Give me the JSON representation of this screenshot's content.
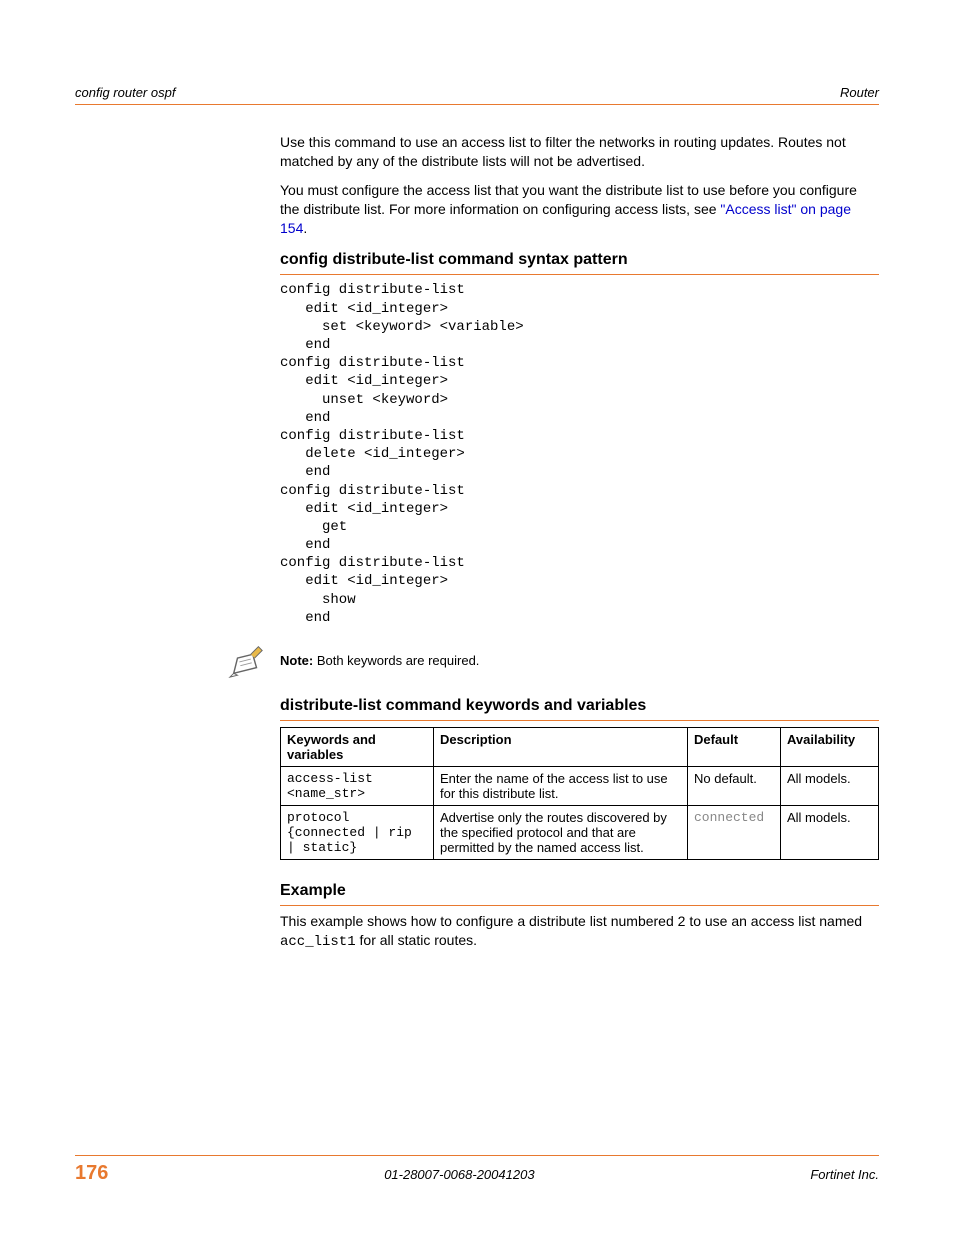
{
  "header": {
    "left": "config router ospf",
    "right": "Router"
  },
  "intro": {
    "p1": "Use this command to use an access list to filter the networks in routing updates. Routes not matched by any of the distribute lists will not be advertised.",
    "p2a": "You must configure the access list that you want the distribute list to use before you configure the distribute list. For more information on configuring access lists, see ",
    "p2_link": "\"Access list\" on page 154",
    "p2b": "."
  },
  "section1": {
    "heading": "config distribute-list command syntax pattern",
    "code": "config distribute-list\n   edit <id_integer>\n     set <keyword> <variable>\n   end\nconfig distribute-list\n   edit <id_integer>\n     unset <keyword>\n   end\nconfig distribute-list\n   delete <id_integer>\n   end\nconfig distribute-list\n   edit <id_integer>\n     get\n   end\nconfig distribute-list\n   edit <id_integer>\n     show\n   end"
  },
  "note": {
    "label": "Note:",
    "text": " Both keywords are required."
  },
  "section2": {
    "heading": "distribute-list command keywords and variables",
    "th1": "Keywords and variables",
    "th2": "Description",
    "th3": "Default",
    "th4": "Availability",
    "rows": [
      {
        "kw": "access-list <name_str>",
        "desc": "Enter the name of the access list to use for this distribute list.",
        "def": "No default.",
        "def_mono": false,
        "avail": "All models."
      },
      {
        "kw": "protocol {connected | rip | static}",
        "desc": "Advertise only the routes discovered by the specified protocol and that are permitted by the named access list.",
        "def": "connected",
        "def_mono": true,
        "avail": "All models."
      }
    ]
  },
  "example": {
    "heading": "Example",
    "p_a": "This example shows how to configure a distribute list numbered 2 to use an access list named ",
    "p_code": "acc_list1",
    "p_b": " for all static routes."
  },
  "footer": {
    "page": "176",
    "docid": "01-28007-0068-20041203",
    "company": "Fortinet Inc."
  }
}
